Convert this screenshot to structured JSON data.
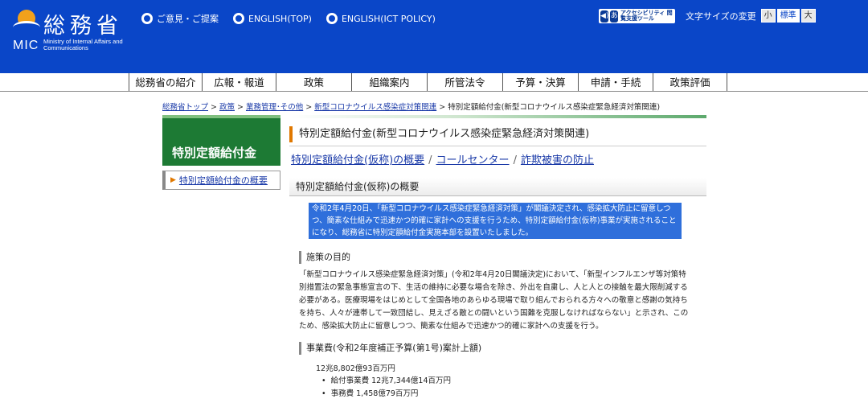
{
  "header": {
    "logo_name": "総務省",
    "logo_mic": "MIC",
    "logo_en": "Ministry of Internal Affairs and Communications",
    "top_links": [
      {
        "label": "ご意見・ご提案"
      },
      {
        "label": "ENGLISH(TOP)"
      },
      {
        "label": "ENGLISH(ICT POLICY)"
      }
    ],
    "accessibility_label": "アクセシビリティ 閲覧支援ツール",
    "fontsize_label": "文字サイズの変更",
    "fontsize_options": [
      "小",
      "標準",
      "大"
    ],
    "fontsize_selected": "標準",
    "brand_color": "#0a46c8"
  },
  "gnav": {
    "items": [
      {
        "label": "総務省の紹介"
      },
      {
        "label": "広報・報道"
      },
      {
        "label": "政策"
      },
      {
        "label": "組織案内"
      },
      {
        "label": "所管法令"
      },
      {
        "label": "予算・決算"
      },
      {
        "label": "申請・手続"
      },
      {
        "label": "政策評価"
      }
    ]
  },
  "breadcrumb": {
    "links": [
      "総務省トップ",
      "政策",
      "業務管理･その他",
      "新型コロナウイルス感染症対策関連"
    ],
    "separator": ">",
    "current": "特別定額給付金(新型コロナウイルス感染症緊急経済対策関連)"
  },
  "side": {
    "title": "特別定額給付金",
    "link": "特別定額給付金の概要"
  },
  "main": {
    "title": "特別定額給付金(新型コロナウイルス感染症緊急経済対策関連)",
    "anchors": [
      "特別定額給付金(仮称)の概要",
      "コールセンター",
      "詐欺被害の防止"
    ],
    "anchor_sep": "/",
    "section_title": "特別定額給付金(仮称)の概要",
    "highlight": "令和2年4月20日、「新型コロナウイルス感染症緊急経済対策」が閣議決定され、感染拡大防止に留意しつつ、簡素な仕組みで迅速かつ的確に家計への支援を行うため、特別定額給付金(仮称)事業が実施されることになり、総務省に特別定額給付金実施本部を設置いたしました。",
    "purpose_heading": "施策の目的",
    "purpose_text": "「新型コロナウイルス感染症緊急経済対策」(令和2年4月20日閣議決定)において、「新型インフルエンザ等対策特別措置法の緊急事態宣言の下、生活の維持に必要な場合を除き、外出を自粛し、人と人との接触を最大限削減する必要がある。医療現場をはじめとして全国各地のあらゆる現場で取り組んでおられる方々への敬意と感謝の気持ちを持ち、人々が連帯して一致団結し、見えざる敵との闘いという国難を克服しなければならない」と示され、このため、感染拡大防止に留意しつつ、簡素な仕組みで迅速かつ的確に家計への支援を行う。",
    "budget_heading": "事業費(令和2年度補正予算(第1号)案計上額)",
    "budget_total": "12兆8,802億93百万円",
    "budget_items": [
      "給付事業費 12兆7,344億14百万円",
      "事務費 1,458億79百万円"
    ]
  }
}
